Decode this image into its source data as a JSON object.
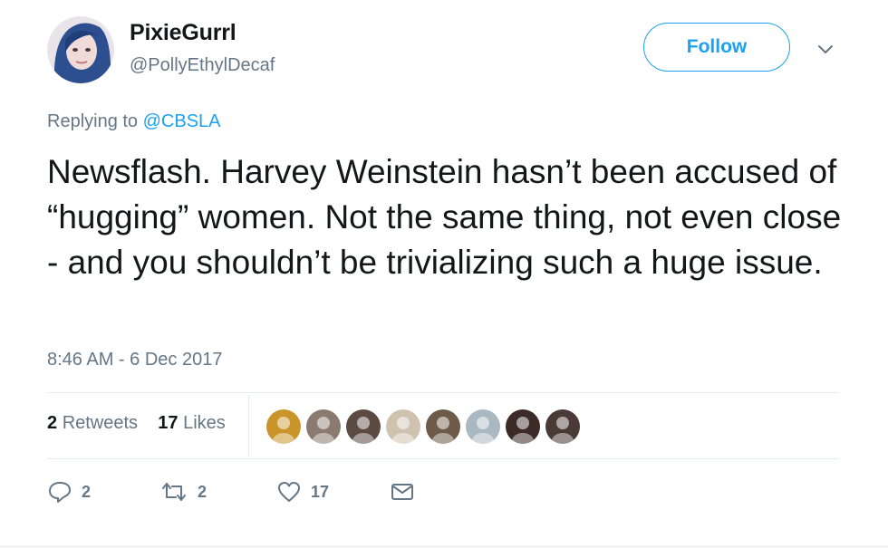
{
  "author": {
    "display_name": "PixieGurrl",
    "handle": "@PollyEthylDecaf",
    "avatar_icon": "profile-photo"
  },
  "follow_label": "Follow",
  "reply": {
    "prefix": "Replying to",
    "mention": "@CBSLA"
  },
  "tweet_text": "Newsflash. Harvey Weinstein hasn’t been accused of “hugging” women. Not the same thing, not even close - and you shouldn’t be trivializing such a huge issue.",
  "timestamp": "8:46 AM - 6 Dec 2017",
  "stats": {
    "retweets_count": "2",
    "retweets_label": "Retweets",
    "likes_count": "17",
    "likes_label": "Likes"
  },
  "liker_avatars": [
    {
      "name": "liker-avatar-1",
      "color": "#c9952b"
    },
    {
      "name": "liker-avatar-2",
      "color": "#8a7a70"
    },
    {
      "name": "liker-avatar-3",
      "color": "#5b4a42"
    },
    {
      "name": "liker-avatar-4",
      "color": "#cfc3b0"
    },
    {
      "name": "liker-avatar-5",
      "color": "#6e5a48"
    },
    {
      "name": "liker-avatar-6",
      "color": "#aab8c2"
    },
    {
      "name": "liker-avatar-7",
      "color": "#3b2a26"
    },
    {
      "name": "liker-avatar-8",
      "color": "#4a3a36"
    }
  ],
  "actions": {
    "reply_count": "2",
    "retweet_count": "2",
    "like_count": "17"
  },
  "colors": {
    "accent": "#1da1f2",
    "secondary_text": "#657786",
    "primary_text": "#14171a",
    "divider": "#e6ecf0"
  }
}
